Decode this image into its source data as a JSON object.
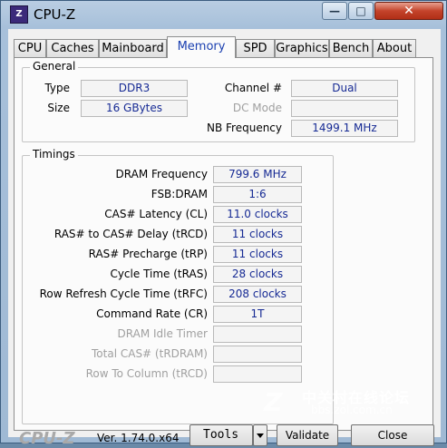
{
  "window": {
    "title": "CPU-Z",
    "icon": "cpu-z-app-icon"
  },
  "tabs": [
    {
      "label": "CPU",
      "active": false
    },
    {
      "label": "Caches",
      "active": false
    },
    {
      "label": "Mainboard",
      "active": false
    },
    {
      "label": "Memory",
      "active": true
    },
    {
      "label": "SPD",
      "active": false
    },
    {
      "label": "Graphics",
      "active": false
    },
    {
      "label": "Bench",
      "active": false
    },
    {
      "label": "About",
      "active": false
    }
  ],
  "general": {
    "title": "General",
    "type_label": "Type",
    "type_value": "DDR3",
    "size_label": "Size",
    "size_value": "16 GBytes",
    "channel_label": "Channel #",
    "channel_value": "Dual",
    "dcmode_label": "DC Mode",
    "dcmode_value": "",
    "nbfreq_label": "NB Frequency",
    "nbfreq_value": "1499.1 MHz"
  },
  "timings": {
    "title": "Timings",
    "rows": [
      {
        "label": "DRAM Frequency",
        "value": "799.6 MHz",
        "dim": false
      },
      {
        "label": "FSB:DRAM",
        "value": "1:6",
        "dim": false
      },
      {
        "label": "CAS# Latency (CL)",
        "value": "11.0 clocks",
        "dim": false
      },
      {
        "label": "RAS# to CAS# Delay (tRCD)",
        "value": "11 clocks",
        "dim": false
      },
      {
        "label": "RAS# Precharge (tRP)",
        "value": "11 clocks",
        "dim": false
      },
      {
        "label": "Cycle Time (tRAS)",
        "value": "28 clocks",
        "dim": false
      },
      {
        "label": "Row Refresh Cycle Time (tRFC)",
        "value": "208 clocks",
        "dim": false
      },
      {
        "label": "Command Rate (CR)",
        "value": "1T",
        "dim": false
      },
      {
        "label": "DRAM Idle Timer",
        "value": "",
        "dim": true
      },
      {
        "label": "Total CAS# (tRDRAM)",
        "value": "",
        "dim": true
      },
      {
        "label": "Row To Column (tRCD)",
        "value": "",
        "dim": true
      }
    ]
  },
  "footer": {
    "brand": "CPU-Z",
    "version": "Ver. 1.74.0.x64",
    "tools_label": "Tools",
    "validate_label": "Validate",
    "close_label": "Close"
  },
  "watermark": {
    "logo": "Z",
    "main": "中关村在线论坛",
    "sub": "bbs.zol.com.cn"
  }
}
